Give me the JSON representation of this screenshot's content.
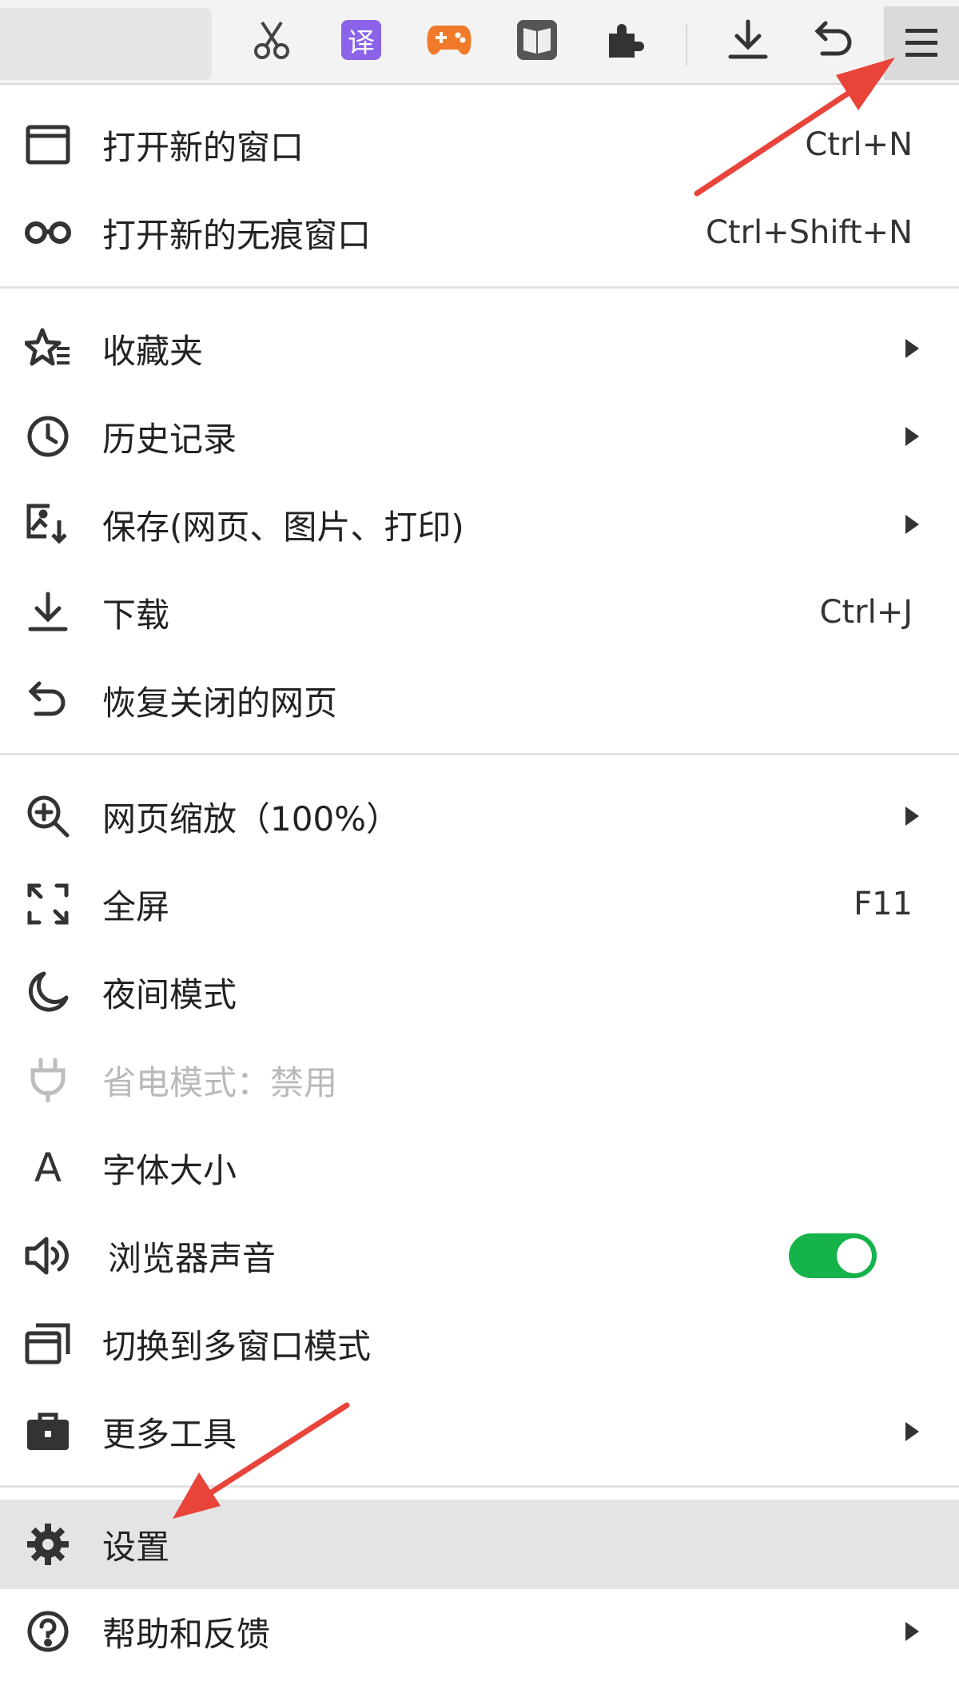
{
  "toolbar": {
    "icons": [
      "scissors-icon",
      "translate-icon",
      "game-controller-icon",
      "reader-icon",
      "extensions-icon",
      "download-icon",
      "undo-icon",
      "menu-icon"
    ],
    "translate_glyph": "译"
  },
  "menu": {
    "items": [
      {
        "label": "打开新的窗口",
        "shortcut": "Ctrl+N"
      },
      {
        "label": "打开新的无痕窗口",
        "shortcut": "Ctrl+Shift+N"
      },
      {
        "label": "收藏夹"
      },
      {
        "label": "历史记录"
      },
      {
        "label": "保存(网页、图片、打印)"
      },
      {
        "label": "下载",
        "shortcut": "Ctrl+J"
      },
      {
        "label": "恢复关闭的网页"
      },
      {
        "label": "网页缩放（100%）"
      },
      {
        "label": "全屏",
        "shortcut": "F11"
      },
      {
        "label": "夜间模式"
      },
      {
        "label": "省电模式：禁用"
      },
      {
        "label": "字体大小",
        "icon_glyph": "A"
      },
      {
        "label": "浏览器声音",
        "toggle_on": true
      },
      {
        "label": "切换到多窗口模式"
      },
      {
        "label": "更多工具"
      },
      {
        "label": "设置"
      },
      {
        "label": "帮助和反馈"
      }
    ]
  },
  "colors": {
    "toggle_on": "#15b34a",
    "annotation_arrow": "#e8443a",
    "highlight_row": "#e4e4e4"
  }
}
